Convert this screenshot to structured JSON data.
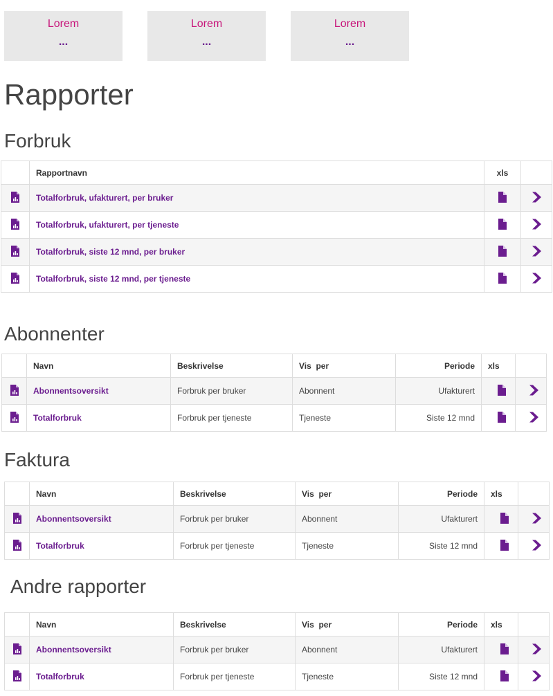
{
  "cards": [
    {
      "title": "Lorem",
      "value": "..."
    },
    {
      "title": "Lorem",
      "value": "..."
    },
    {
      "title": "Lorem",
      "value": "..."
    }
  ],
  "page_title": "Rapporter",
  "forbruk": {
    "heading": "Forbruk",
    "columns": {
      "name": "Rapportnavn",
      "xls": "xls"
    },
    "rows": [
      {
        "name": "Totalforbruk, ufakturert, per bruker"
      },
      {
        "name": "Totalforbruk, ufakturert, per tjeneste"
      },
      {
        "name": "Totalforbruk, siste 12 mnd, per bruker"
      },
      {
        "name": "Totalforbruk, siste 12 mnd, per tjeneste"
      }
    ]
  },
  "abonnenter": {
    "heading": "Abonnenter",
    "columns": {
      "name": "Navn",
      "desc": "Beskrivelse",
      "vis": "Vis  per",
      "period": "Periode",
      "xls": "xls"
    },
    "rows": [
      {
        "name": "Abonnentsoversikt",
        "desc": "Forbruk per bruker",
        "vis": "Abonnent",
        "period": "Ufakturert"
      },
      {
        "name": "Totalforbruk",
        "desc": "Forbruk per tjeneste",
        "vis": "Tjeneste",
        "period": "Siste 12 mnd"
      }
    ]
  },
  "faktura": {
    "heading": "Faktura",
    "columns": {
      "name": "Navn",
      "desc": "Beskrivelse",
      "vis": "Vis  per",
      "period": "Periode",
      "xls": "xls"
    },
    "rows": [
      {
        "name": "Abonnentsoversikt",
        "desc": "Forbruk per bruker",
        "vis": "Abonnent",
        "period": "Ufakturert"
      },
      {
        "name": "Totalforbruk",
        "desc": "Forbruk per tjeneste",
        "vis": "Tjeneste",
        "period": "Siste 12 mnd"
      }
    ]
  },
  "andre": {
    "heading": "Andre rapporter",
    "columns": {
      "name": "Navn",
      "desc": "Beskrivelse",
      "vis": "Vis  per",
      "period": "Periode",
      "xls": "xls"
    },
    "rows": [
      {
        "name": "Abonnentsoversikt",
        "desc": "Forbruk per bruker",
        "vis": "Abonnent",
        "period": "Ufakturert"
      },
      {
        "name": "Totalforbruk",
        "desc": "Forbruk per tjeneste",
        "vis": "Tjeneste",
        "period": "Siste 12 mnd"
      }
    ]
  },
  "icons": {
    "report": "report-chart-icon",
    "xls": "xls-file-icon",
    "open": "chevron-right-icon"
  },
  "colors": {
    "accent": "#6b1d8f",
    "card_title": "#c7157a",
    "card_bg": "#e8e8e8",
    "row_stripe": "#f5f5f5",
    "border": "#dddddd"
  }
}
